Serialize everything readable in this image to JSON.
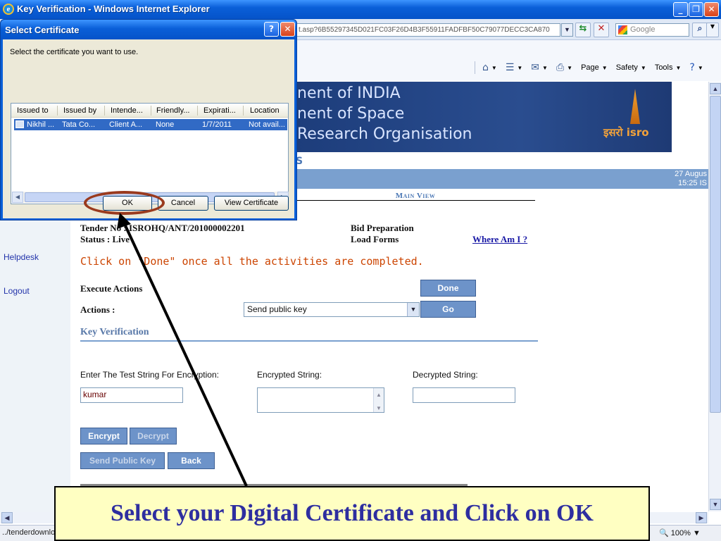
{
  "window": {
    "title": "Key Verification - Windows Internet Explorer"
  },
  "address": {
    "url": "t.asp?6B55297345D021FC03F26D4B3F55911FADFBF50C79077DECC3CA870",
    "search_placeholder": "Google"
  },
  "commands": {
    "page": "Page",
    "safety": "Safety",
    "tools": "Tools"
  },
  "banner": {
    "line1": "nent of INDIA",
    "line2": "nent of Space",
    "line3": "Research Organisation",
    "logo_text": "इसरो isro"
  },
  "page": {
    "section_fragment": "S",
    "date": "27 Augus",
    "time": "15:25  IS",
    "main_view": "Main View",
    "tender_no": "Tender No : ISROHQ/ANT/201000002201",
    "status": "Status : Live",
    "bid_prep": "Bid Preparation",
    "load_forms": "Load Forms",
    "where_am_i": "Where Am I ?",
    "click_msg": "Click on \"Done\" once all the activities are completed.",
    "execute_actions": "Execute Actions",
    "done": "Done",
    "actions_label": "Actions :",
    "action_selected": "Send public key",
    "go": "Go",
    "key_verification": "Key Verification",
    "test_label": "Enter The Test String For Encryption:",
    "encrypted_label": "Encrypted String:",
    "decrypted_label": "Decrypted String:",
    "test_value": "kumar",
    "encrypt": "Encrypt",
    "decrypt": "Decrypt",
    "send_public_key": "Send Public Key",
    "back": "Back"
  },
  "nav": {
    "helpdesk": "Helpdesk",
    "logout": "Logout"
  },
  "status_bar": {
    "path": "../tenderdownlo",
    "zoom": "100%"
  },
  "dialog": {
    "title": "Select Certificate",
    "prompt": "Select the certificate you want to use.",
    "columns": [
      "Issued to",
      "Issued by",
      "Intende...",
      "Friendly...",
      "Expirati...",
      "Location"
    ],
    "row": [
      "Nikhil ...",
      "Tata Co...",
      "Client A...",
      "None",
      "1/7/2011",
      "Not avail..."
    ],
    "ok": "OK",
    "cancel": "Cancel",
    "view_certificate": "View Certificate"
  },
  "callout": {
    "text": "Select your Digital Certificate and Click on OK"
  },
  "colors": {
    "accent_blue": "#7aa0cf",
    "highlight_ring": "#9a3a1e",
    "callout_bg": "#ffffc2",
    "callout_text": "#2e2ea0"
  }
}
